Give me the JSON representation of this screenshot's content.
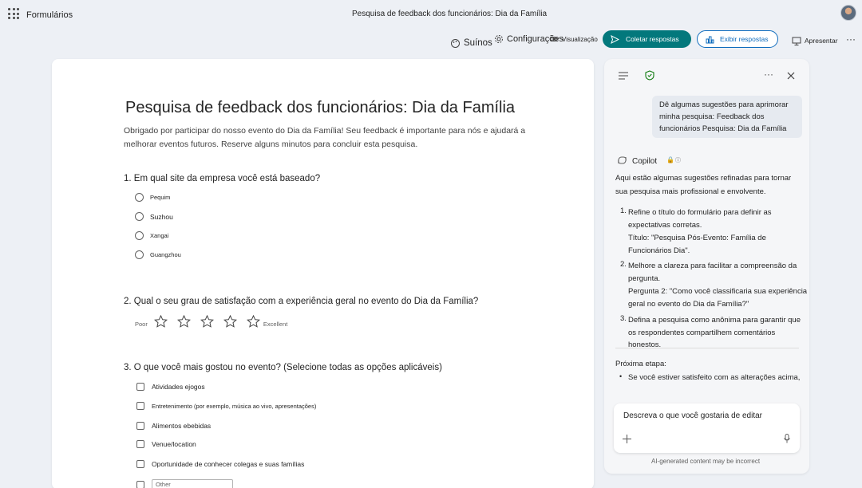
{
  "app": {
    "name": "Formulários",
    "document_title": "Pesquisa de feedback dos funcionários: Dia da Família"
  },
  "toolbar": {
    "themes_label": "Suínos",
    "settings_label": "Configurações",
    "preview_label": "Visualização",
    "collect_label": "Coletar respostas",
    "view_responses_label": "Exibir respostas",
    "present_label": "Apresentar"
  },
  "form": {
    "title": "Pesquisa de feedback dos funcionários: Dia da Família",
    "description": "Obrigado por participar do nosso evento do Dia da Família! Seu feedback é importante para nós e ajudará a melhorar eventos futuros. Reserve alguns minutos para concluir esta pesquisa.",
    "questions": [
      {
        "title": "1. Em qual site da empresa você está baseado?",
        "options": [
          "Pequim",
          "Suzhou",
          "Xangai",
          "Guangzhou"
        ]
      },
      {
        "title": "2.  Qual o seu grau de satisfação com a experiência geral no evento do Dia da Família?",
        "rating": {
          "low_label": "Poor",
          "high_label": "Excellent",
          "stars": 5
        }
      },
      {
        "title": "3.  O que você mais gostou no evento? (Selecione todas as opções aplicáveis)",
        "options": [
          "Atividades ejogos",
          "Entretenimento (por exemplo, música ao vivo, apresentações)",
          "Alimentos ebebidas",
          "Venue/location",
          "Oportunidade de conhecer colegas e suas famílias"
        ],
        "other_placeholder": "Other"
      }
    ]
  },
  "copilot": {
    "user_message": "Dê algumas sugestões para aprimorar minha pesquisa: Feedback dos funcionários Pesquisa: Dia da Família",
    "name": "Copilot",
    "intro": "Aqui estão algumas sugestões refinadas para tornar sua pesquisa mais profissional e envolvente.",
    "suggestions": [
      {
        "num": "1.",
        "text": "Refine o título do formulário para definir as expectativas corretas.",
        "detail": "Título: \"Pesquisa Pós-Evento: Família de Funcionários Dia\"."
      },
      {
        "num": "2.",
        "text": "Melhore a clareza para facilitar a compreensão da pergunta.",
        "detail": "Pergunta 2: \"Como você classificaria sua experiência geral no evento do Dia da Família?\""
      },
      {
        "num": "3.",
        "text": "Defina a pesquisa como anônima para garantir que os respondentes compartilhem comentários honestos."
      }
    ],
    "next_step_label": "Próxima etapa:",
    "next_step_item": "Se você estiver satisfeito com as alterações acima,",
    "input_placeholder": "Descreva o que você gostaria de editar",
    "disclaimer": "AI-generated content may be incorrect"
  },
  "colors": {
    "accent": "#03787c",
    "link": "#0f6cbd",
    "background": "#edf0f5",
    "shield": "#107c10"
  }
}
